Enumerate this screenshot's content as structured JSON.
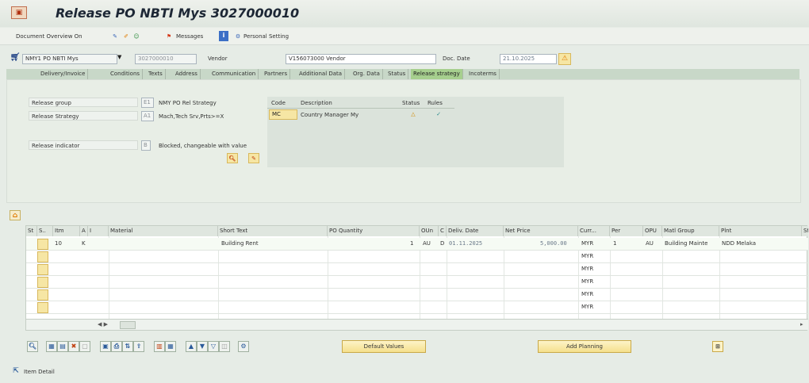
{
  "title": "Release PO NBTI Mys 3027000010",
  "toolbar": {
    "doc_overview": "Document Overview On",
    "messages": "Messages",
    "personal_setting": "Personal Setting"
  },
  "header": {
    "doc_type": "NMY1 PO NBTI Mys",
    "po_number": "3027000010",
    "vendor_label": "Vendor",
    "vendor_value": "V156073000 Vendor",
    "doc_date_label": "Doc. Date",
    "doc_date_value": "21.10.2025"
  },
  "tabs": [
    {
      "label": "Delivery/Invoice"
    },
    {
      "label": "Conditions"
    },
    {
      "label": "Texts"
    },
    {
      "label": "Address"
    },
    {
      "label": "Communication"
    },
    {
      "label": "Partners"
    },
    {
      "label": "Additional Data"
    },
    {
      "label": "Org. Data"
    },
    {
      "label": "Status"
    },
    {
      "label": "Release strategy"
    },
    {
      "label": "Incoterms"
    }
  ],
  "release": {
    "group_label": "Release group",
    "group_code": "E1",
    "group_desc": "NMY PO Rel Strategy",
    "strategy_label": "Release Strategy",
    "strategy_code": "A1",
    "strategy_desc": "Mach,Tech Srv,Prts>=X",
    "indicator_label": "Release indicator",
    "indicator_code": "B",
    "indicator_desc": "Blocked, changeable with value",
    "table": {
      "col_code": "Code",
      "col_desc": "Description",
      "col_status": "Status",
      "col_rules": "Rules",
      "row_code": "MC",
      "row_desc": "Country Manager My"
    }
  },
  "items": {
    "headers": [
      "St",
      "S..",
      "Itm",
      "A",
      "I",
      "Material",
      "Short Text",
      "PO Quantity",
      "OUn",
      "C",
      "Deliv. Date",
      "Net Price",
      "Curr...",
      "Per",
      "OPU",
      "Matl Group",
      "Plnt",
      "St"
    ],
    "row1": {
      "item": "10",
      "acct": "K",
      "short_text": "Building Rent",
      "qty": "1",
      "oun": "AU",
      "c": "D",
      "deliv_date": "01.11.2025",
      "net_price": "5,000.00",
      "curr": "MYR",
      "per": "1",
      "opu": "AU",
      "matl_group": "Building Mainte",
      "plant": "NDD Melaka"
    },
    "empty_curr": "MYR"
  },
  "buttons": {
    "default_values": "Default Values",
    "add_planning": "Add Planning"
  },
  "footer": {
    "item_detail": "Item Detail"
  },
  "colors": {
    "active_tab": "#a6cf8e",
    "button_yellow": "#f5e08d"
  }
}
